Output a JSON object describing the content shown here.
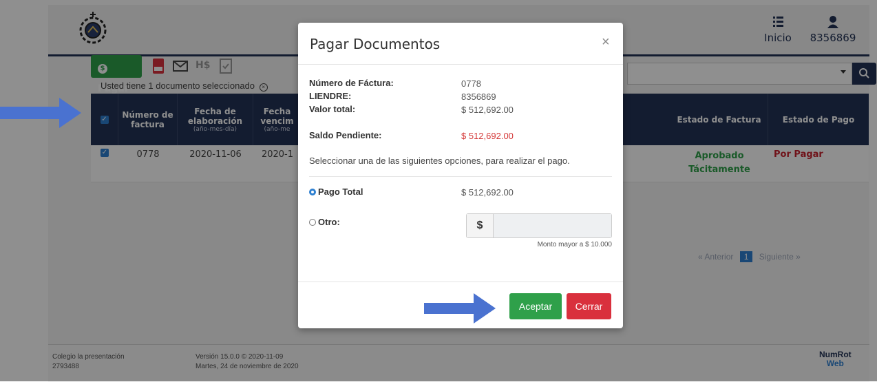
{
  "header": {
    "home_label": "Inicio",
    "user_label": "8356869"
  },
  "toolbar": {
    "pay_label": "Pagar",
    "selected_text": "Usted tiene 1 documento seleccionado",
    "hs_label": "H$"
  },
  "table": {
    "headers": [
      {
        "title": "Número de factura",
        "sub": ""
      },
      {
        "title": "Fecha de elaboración",
        "sub": "(año-mes-día)"
      },
      {
        "title": "Fecha vencim",
        "sub": "(año-me"
      },
      {
        "title": "Estado de Factura",
        "sub": ""
      },
      {
        "title": "Estado de Pago",
        "sub": ""
      }
    ],
    "rows": [
      {
        "numero": "0778",
        "fecha_elaboracion": "2020-11-06",
        "fecha_vencimiento": "2020-1",
        "estado_factura": "Aprobado Tácitamente",
        "estado_pago": "Por Pagar"
      }
    ]
  },
  "pagination": {
    "prev": "« Anterior",
    "current": "1",
    "next": "Siguiente »"
  },
  "footer": {
    "school": "Colegio la presentación",
    "code": "2793488",
    "version": "Versión 15.0.0 © 2020-11-09",
    "date": "Martes, 24 de noviembre de 2020",
    "brand_top": "NumRot",
    "brand_bottom": "Web"
  },
  "modal": {
    "title": "Pagar Documentos",
    "close": "×",
    "fields": [
      {
        "label": "Número de Fáctura:",
        "value": "0778"
      },
      {
        "label": "LIENDRE:",
        "value": "8356869"
      },
      {
        "label": "Valor total:",
        "value": "$ 512,692.00"
      }
    ],
    "saldo_label": "Saldo Pendiente:",
    "saldo_value": "$ 512,692.00",
    "instruction": "Seleccionar una de las siguientes opciones, para realizar el pago.",
    "option_total_label": "Pago Total",
    "option_total_value": "$ 512,692.00",
    "option_other_label": "Otro:",
    "currency_symbol": "$",
    "amount_value": "",
    "min_note": "Monto mayor a $ 10.000",
    "accept_label": "Aceptar",
    "close_label": "Cerrar"
  },
  "colors": {
    "navy": "#233356",
    "green": "#2fa04a",
    "red": "#d9303d",
    "blue_arrow": "#4a72d0"
  }
}
